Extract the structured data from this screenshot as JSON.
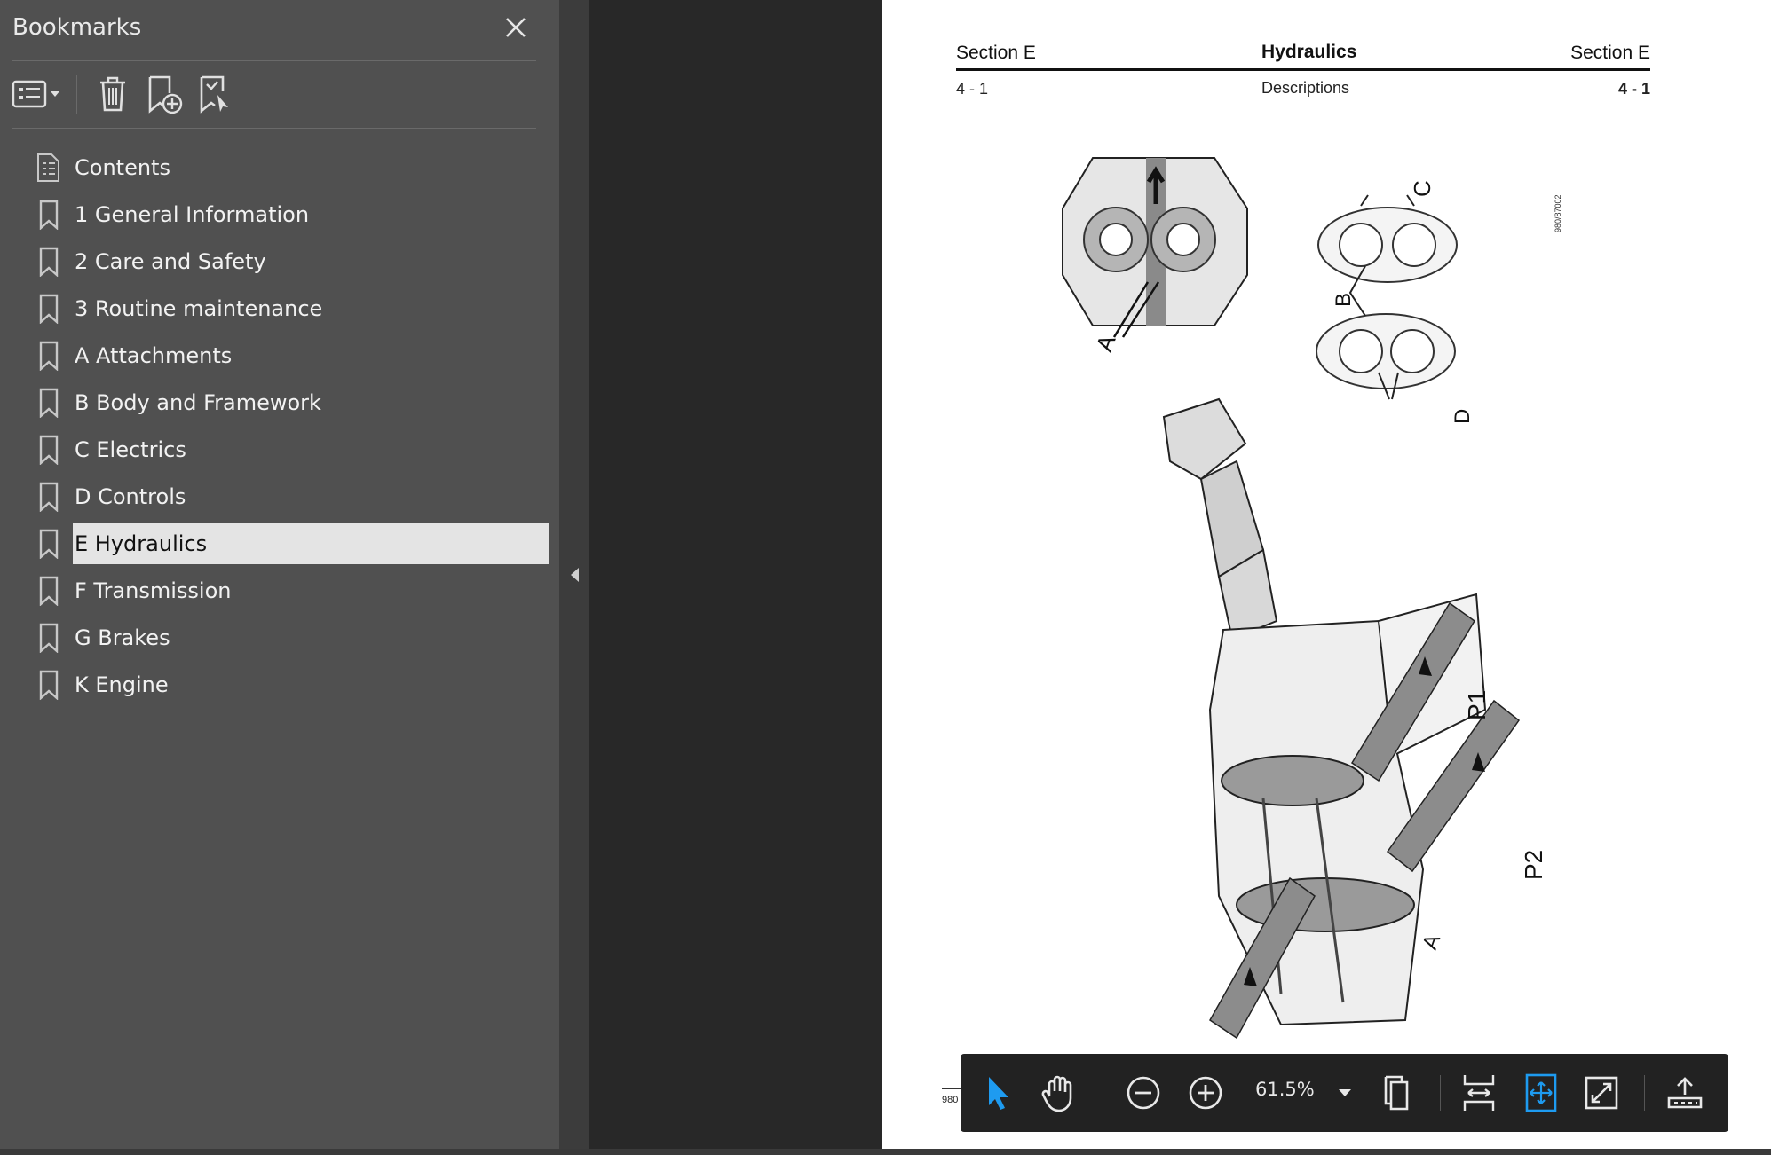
{
  "sidebar": {
    "title": "Bookmarks",
    "items": [
      {
        "label": "Contents",
        "icon": "contents-icon"
      },
      {
        "label": "1 General Information",
        "icon": "bookmark-icon"
      },
      {
        "label": "2 Care and Safety",
        "icon": "bookmark-icon"
      },
      {
        "label": "3 Routine maintenance",
        "icon": "bookmark-icon"
      },
      {
        "label": "A Attachments",
        "icon": "bookmark-icon"
      },
      {
        "label": "B Body and Framework",
        "icon": "bookmark-icon"
      },
      {
        "label": "C Electrics",
        "icon": "bookmark-icon"
      },
      {
        "label": "D Controls",
        "icon": "bookmark-icon"
      },
      {
        "label": "E Hydraulics",
        "icon": "bookmark-icon",
        "selected": true
      },
      {
        "label": "F Transmission",
        "icon": "bookmark-icon"
      },
      {
        "label": "G Brakes",
        "icon": "bookmark-icon"
      },
      {
        "label": "K Engine",
        "icon": "bookmark-icon"
      }
    ]
  },
  "document": {
    "header_left": "Section E",
    "header_center": "Hydraulics",
    "header_right": "Section E",
    "sub_left": "4 - 1",
    "sub_center": "Descriptions",
    "sub_right": "4 - 1",
    "figure_labels": {
      "a": "A",
      "b": "B",
      "c": "C",
      "d": "D",
      "p1": "P1",
      "p2": "P2",
      "a2": "A"
    },
    "figure_code": "980/87002",
    "footer_fragment": "980"
  },
  "toolbar": {
    "zoom": "61.5%"
  },
  "colors": {
    "sidebar_bg": "#505050",
    "selection_bg": "#e4e4e4",
    "accent": "#1e9bf0",
    "floatbar_bg": "#222222"
  }
}
